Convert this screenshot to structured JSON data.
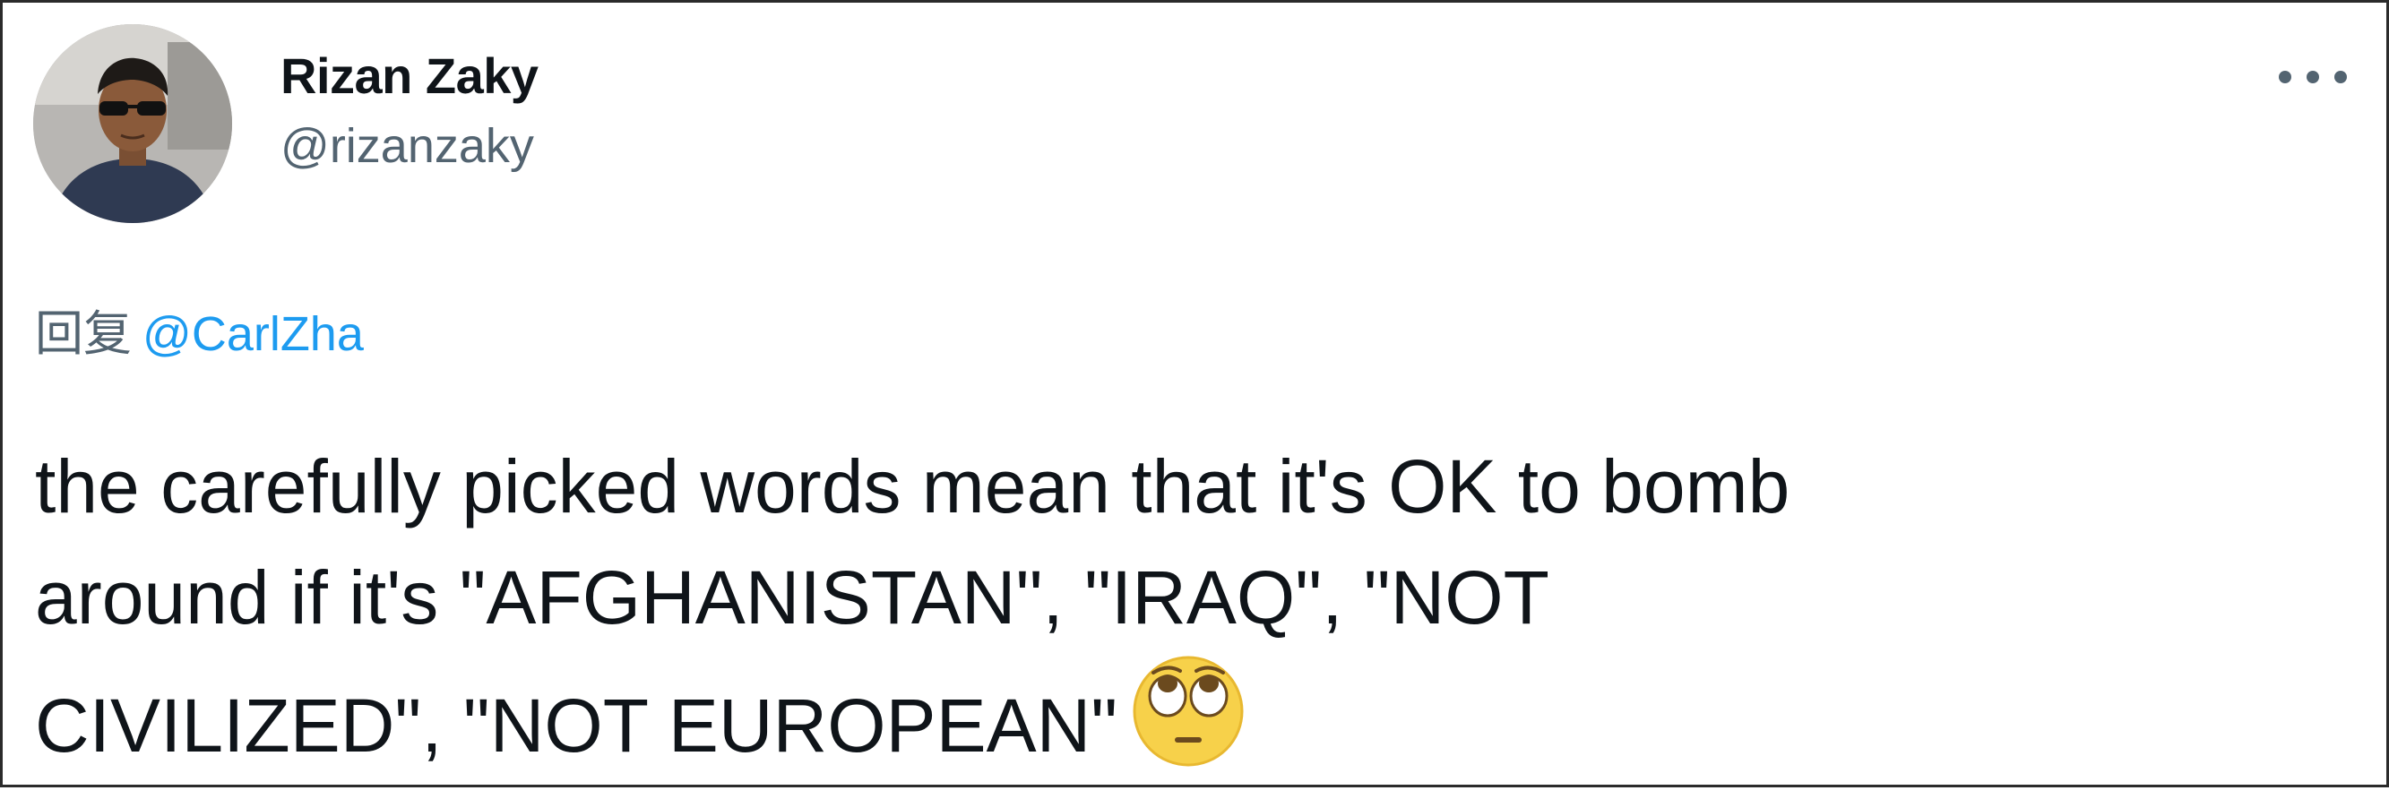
{
  "author": {
    "name": "Rizan Zaky",
    "handle": "@rizanzaky"
  },
  "reply": {
    "prefix": "回复",
    "target": "@CarlZha"
  },
  "tweet": {
    "line1": "the carefully picked words mean that it's OK to bomb",
    "line2": "around if it's \"AFGHANISTAN\", \"IRAQ\", \"NOT",
    "line3": "CIVILIZED\", \"NOT EUROPEAN\""
  },
  "icons": {
    "more": "more-options-icon",
    "emoji": "face-with-rolling-eyes-emoji"
  },
  "colors": {
    "text": "#0f1419",
    "secondary": "#536471",
    "link": "#1d9bf0",
    "border": "#2b2b2b"
  }
}
